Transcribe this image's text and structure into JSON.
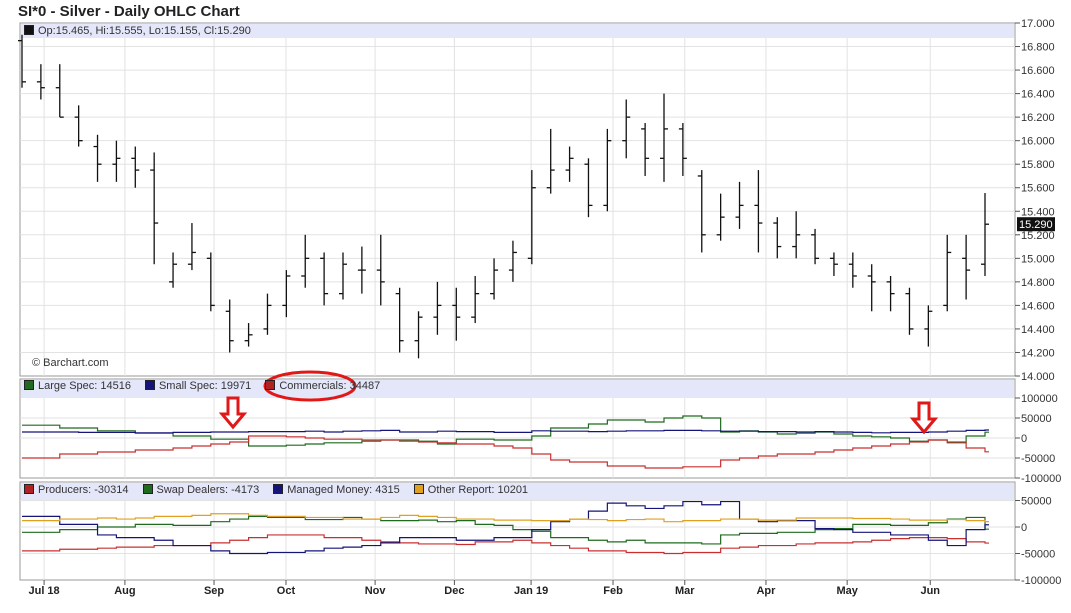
{
  "header": {
    "title": "SI*0 - Silver - Daily OHLC Chart"
  },
  "price_legend": "Op:15.465, Hi:15.555, Lo:15.155, Cl:15.290",
  "last_price_label": "15.290",
  "credit": "© Barchart.com",
  "cot_legend": [
    {
      "label": "Large Spec: 14516",
      "color": "#1e6b1e"
    },
    {
      "label": "Small Spec: 19971",
      "color": "#14147a"
    },
    {
      "label": "Commercials: 34487",
      "color": "#b22222"
    }
  ],
  "disagg_legend": [
    {
      "label": "Producers: -30314",
      "color": "#b22222"
    },
    {
      "label": "Swap Dealers: -4173",
      "color": "#1e6b1e"
    },
    {
      "label": "Managed Money: 4315",
      "color": "#14147a"
    },
    {
      "label": "Other Report: 10201",
      "color": "#e0a020"
    }
  ],
  "chart_data": [
    {
      "type": "ohlc",
      "title": "SI*0 - Silver - Daily OHLC Chart",
      "ylim": [
        14.0,
        17.0
      ],
      "yticks": [
        "14.000",
        "14.200",
        "14.400",
        "14.600",
        "14.800",
        "15.000",
        "15.200",
        "15.400",
        "15.600",
        "15.800",
        "16.000",
        "16.200",
        "16.400",
        "16.600",
        "16.800",
        "17.000"
      ],
      "x_unit": "week index",
      "xlim": [
        0,
        51
      ],
      "month_ticks": [
        {
          "label": "Jul 18",
          "x": 1.17
        },
        {
          "label": "Aug",
          "x": 5.45
        },
        {
          "label": "Sep",
          "x": 10.17
        },
        {
          "label": "Oct",
          "x": 13.98
        },
        {
          "label": "Nov",
          "x": 18.7
        },
        {
          "label": "Dec",
          "x": 22.9
        },
        {
          "label": "Jan 19",
          "x": 26.96
        },
        {
          "label": "Feb",
          "x": 31.3
        },
        {
          "label": "Mar",
          "x": 35.1
        },
        {
          "label": "Apr",
          "x": 39.4
        },
        {
          "label": "May",
          "x": 43.7
        },
        {
          "label": "Jun",
          "x": 48.1
        }
      ],
      "ohlc": [
        [
          16.85,
          16.9,
          16.45,
          16.5
        ],
        [
          16.5,
          16.65,
          16.35,
          16.45
        ],
        [
          16.45,
          16.65,
          16.2,
          16.2
        ],
        [
          16.2,
          16.3,
          15.95,
          16.0
        ],
        [
          15.95,
          16.05,
          15.65,
          15.8
        ],
        [
          15.8,
          16.0,
          15.65,
          15.85
        ],
        [
          15.85,
          15.95,
          15.6,
          15.75
        ],
        [
          15.75,
          15.9,
          14.95,
          15.3
        ],
        [
          14.8,
          15.05,
          14.75,
          14.95
        ],
        [
          14.95,
          15.3,
          14.9,
          15.05
        ],
        [
          15.0,
          15.05,
          14.55,
          14.6
        ],
        [
          14.55,
          14.65,
          14.2,
          14.3
        ],
        [
          14.3,
          14.45,
          14.25,
          14.35
        ],
        [
          14.4,
          14.7,
          14.35,
          14.6
        ],
        [
          14.6,
          14.9,
          14.5,
          14.85
        ],
        [
          14.85,
          15.2,
          14.75,
          15.0
        ],
        [
          15.0,
          15.05,
          14.6,
          14.7
        ],
        [
          14.7,
          15.05,
          14.65,
          14.95
        ],
        [
          14.9,
          15.1,
          14.7,
          14.9
        ],
        [
          14.9,
          15.2,
          14.6,
          14.8
        ],
        [
          14.7,
          14.75,
          14.2,
          14.3
        ],
        [
          14.3,
          14.55,
          14.15,
          14.5
        ],
        [
          14.5,
          14.8,
          14.35,
          14.6
        ],
        [
          14.6,
          14.75,
          14.3,
          14.5
        ],
        [
          14.5,
          14.85,
          14.45,
          14.7
        ],
        [
          14.7,
          15.0,
          14.65,
          14.9
        ],
        [
          14.9,
          15.15,
          14.8,
          15.05
        ],
        [
          15.0,
          15.75,
          14.95,
          15.6
        ],
        [
          15.6,
          16.1,
          15.55,
          15.75
        ],
        [
          15.75,
          15.95,
          15.65,
          15.85
        ],
        [
          15.8,
          15.85,
          15.35,
          15.45
        ],
        [
          15.45,
          16.1,
          15.4,
          16.0
        ],
        [
          16.0,
          16.35,
          15.85,
          16.2
        ],
        [
          16.1,
          16.15,
          15.7,
          15.85
        ],
        [
          15.85,
          16.4,
          15.65,
          16.1
        ],
        [
          16.1,
          16.15,
          15.7,
          15.85
        ],
        [
          15.7,
          15.75,
          15.05,
          15.2
        ],
        [
          15.2,
          15.55,
          15.15,
          15.35
        ],
        [
          15.35,
          15.65,
          15.25,
          15.45
        ],
        [
          15.45,
          15.75,
          15.05,
          15.3
        ],
        [
          15.3,
          15.35,
          15.0,
          15.1
        ],
        [
          15.1,
          15.4,
          15.0,
          15.2
        ],
        [
          15.2,
          15.25,
          14.95,
          15.0
        ],
        [
          15.0,
          15.05,
          14.85,
          14.95
        ],
        [
          14.95,
          15.05,
          14.75,
          14.85
        ],
        [
          14.85,
          14.95,
          14.55,
          14.8
        ],
        [
          14.8,
          14.85,
          14.55,
          14.7
        ],
        [
          14.7,
          14.75,
          14.35,
          14.4
        ],
        [
          14.4,
          14.6,
          14.25,
          14.55
        ],
        [
          14.6,
          15.2,
          14.55,
          15.05
        ],
        [
          15.0,
          15.2,
          14.65,
          14.9
        ],
        [
          14.95,
          15.555,
          14.85,
          15.29
        ]
      ]
    },
    {
      "type": "line",
      "step": true,
      "title": "COT Legacy",
      "ylim": [
        -100000,
        100000
      ],
      "yticks": [
        "100000",
        "50000",
        "0",
        "-50000",
        "-100000"
      ],
      "series": [
        {
          "name": "Large Spec",
          "color": "#1e6b1e",
          "values": [
            32000,
            32000,
            25000,
            25000,
            18000,
            18000,
            12000,
            12000,
            5000,
            5000,
            -3000,
            -3000,
            -20000,
            -20000,
            -18000,
            -15000,
            -12000,
            -12000,
            -8000,
            -5000,
            -5000,
            -8000,
            -15000,
            -3000,
            -3000,
            -5000,
            -5000,
            5000,
            25000,
            25000,
            35000,
            45000,
            45000,
            40000,
            50000,
            55000,
            50000,
            15000,
            18000,
            15000,
            10000,
            12000,
            15000,
            10000,
            5000,
            3000,
            0,
            -8000,
            -5000,
            -12000,
            5000,
            14516
          ]
        },
        {
          "name": "Small Spec",
          "color": "#14147a",
          "values": [
            15000,
            15000,
            15000,
            14000,
            14000,
            14000,
            13000,
            13000,
            14000,
            14000,
            15000,
            15000,
            16000,
            16000,
            16000,
            17000,
            15000,
            17000,
            18000,
            19000,
            15000,
            15000,
            17000,
            16000,
            16000,
            14000,
            14000,
            18000,
            17000,
            17000,
            16000,
            17000,
            18000,
            18000,
            19000,
            19000,
            18000,
            17000,
            17000,
            16000,
            16000,
            15000,
            16000,
            15000,
            14000,
            13000,
            14000,
            14000,
            15000,
            17000,
            19000,
            19971
          ]
        },
        {
          "name": "Commercials",
          "color": "#c83030",
          "values": [
            -50000,
            -50000,
            -40000,
            -40000,
            -35000,
            -35000,
            -30000,
            -30000,
            -25000,
            -20000,
            -15000,
            -10000,
            5000,
            5000,
            3000,
            0,
            -3000,
            -3000,
            -5000,
            -5000,
            -8000,
            -10000,
            -12000,
            -15000,
            -15000,
            -20000,
            -25000,
            -40000,
            -55000,
            -60000,
            -60000,
            -70000,
            -70000,
            -75000,
            -75000,
            -72000,
            -72000,
            -55000,
            -50000,
            -45000,
            -40000,
            -40000,
            -35000,
            -30000,
            -25000,
            -20000,
            -15000,
            -10000,
            -5000,
            -10000,
            -25000,
            -34487
          ]
        }
      ]
    },
    {
      "type": "line",
      "step": true,
      "title": "COT Disaggregated",
      "ylim": [
        -100000,
        50000
      ],
      "yticks": [
        "50000",
        "0",
        "-50000",
        "-100000"
      ],
      "series": [
        {
          "name": "Producers",
          "color": "#c83030",
          "values": [
            -45000,
            -45000,
            -42000,
            -42000,
            -40000,
            -38000,
            -38000,
            -35000,
            -35000,
            -35000,
            -30000,
            -25000,
            -20000,
            -15000,
            -15000,
            -15000,
            -20000,
            -20000,
            -25000,
            -28000,
            -30000,
            -32000,
            -32000,
            -33000,
            -28000,
            -28000,
            -25000,
            -30000,
            -35000,
            -40000,
            -45000,
            -45000,
            -48000,
            -48000,
            -50000,
            -48000,
            -48000,
            -40000,
            -38000,
            -35000,
            -35000,
            -32000,
            -30000,
            -30000,
            -28000,
            -25000,
            -22000,
            -20000,
            -20000,
            -22000,
            -28000,
            -30314
          ]
        },
        {
          "name": "Swap Dealers",
          "color": "#1e6b1e",
          "values": [
            -10000,
            -10000,
            -5000,
            -5000,
            0,
            0,
            5000,
            5000,
            3000,
            3000,
            10000,
            15000,
            20000,
            18000,
            18000,
            14000,
            14000,
            18000,
            15000,
            12000,
            12000,
            13000,
            10000,
            12000,
            5000,
            3000,
            -5000,
            -8000,
            -20000,
            -20000,
            -25000,
            -28000,
            -25000,
            -30000,
            -30000,
            -30000,
            -32000,
            -15000,
            -12000,
            -12000,
            -10000,
            -10000,
            -5000,
            -3000,
            5000,
            5000,
            3000,
            3000,
            8000,
            15000,
            18000,
            -4173
          ]
        },
        {
          "name": "Managed Money",
          "color": "#14147a",
          "values": [
            20000,
            20000,
            5000,
            5000,
            -15000,
            -20000,
            -20000,
            -25000,
            -35000,
            -35000,
            -45000,
            -50000,
            -50000,
            -48000,
            -48000,
            -45000,
            -40000,
            -38000,
            -35000,
            -30000,
            -20000,
            -20000,
            -20000,
            -25000,
            -25000,
            -20000,
            -20000,
            -5000,
            10000,
            15000,
            30000,
            45000,
            40000,
            35000,
            40000,
            48000,
            42000,
            48000,
            15000,
            10000,
            12000,
            12000,
            -3000,
            -5000,
            -10000,
            -10000,
            -15000,
            -15000,
            -25000,
            -35000,
            -5000,
            4315
          ]
        },
        {
          "name": "Other Report",
          "color": "#e0a020",
          "values": [
            12000,
            12000,
            15000,
            15000,
            17000,
            15000,
            17000,
            20000,
            20000,
            22000,
            25000,
            25000,
            22000,
            20000,
            20000,
            18000,
            18000,
            15000,
            15000,
            18000,
            22000,
            20000,
            18000,
            15000,
            15000,
            13000,
            13000,
            12000,
            12000,
            15000,
            14000,
            12000,
            14000,
            15000,
            10000,
            12000,
            12000,
            15000,
            15000,
            13000,
            13000,
            17000,
            17000,
            17000,
            16000,
            16000,
            15000,
            13000,
            13000,
            14000,
            12000,
            10201
          ]
        }
      ]
    }
  ]
}
